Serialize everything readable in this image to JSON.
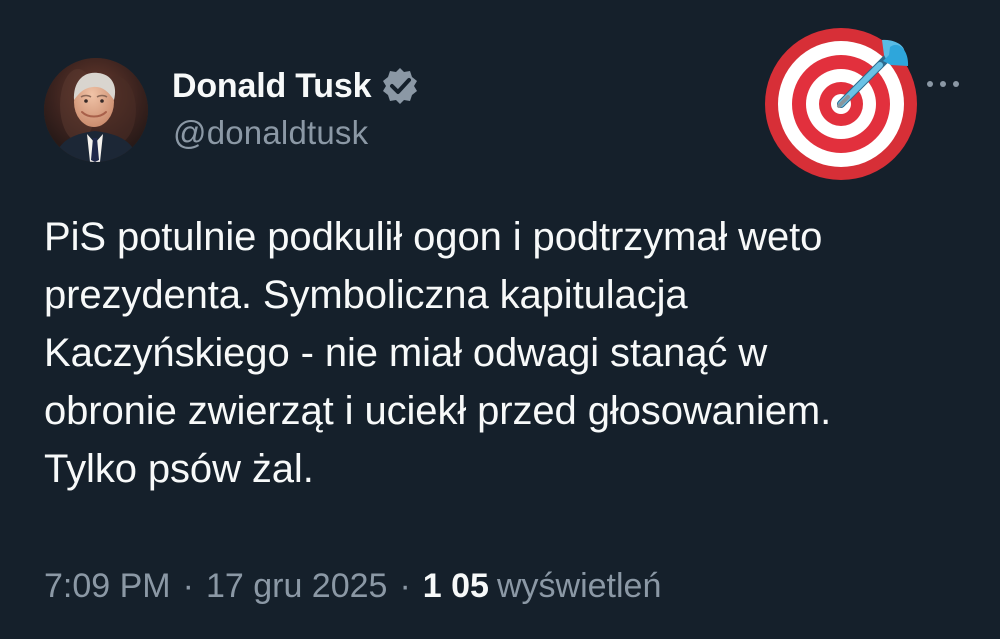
{
  "author": {
    "display_name": "Donald Tusk",
    "handle": "@donaldtusk",
    "verified": true
  },
  "tweet": {
    "text": "PiS potulnie podkulił ogon i podtrzymał weto\nprezydenta. Symboliczna  kapitulacja\nKaczyńskiego - nie miał odwagi stanąć w\nobronie zwierząt i uciekł przed głosowaniem.\nTylko psów żal.",
    "time": "7:09 PM",
    "separator": "·",
    "date": "17 gru 2025",
    "views_count": "1 05",
    "views_label": "wyświetleń"
  },
  "icons": {
    "verified": "verified-badge-icon",
    "target": "target-emoji-icon",
    "more": "more-options-icon"
  },
  "colors": {
    "background": "#15202b",
    "primary_text": "#f7f9f9",
    "secondary_text": "#8b98a5",
    "target_red": "#e2303d",
    "verified_badge": "#8b98a5"
  }
}
